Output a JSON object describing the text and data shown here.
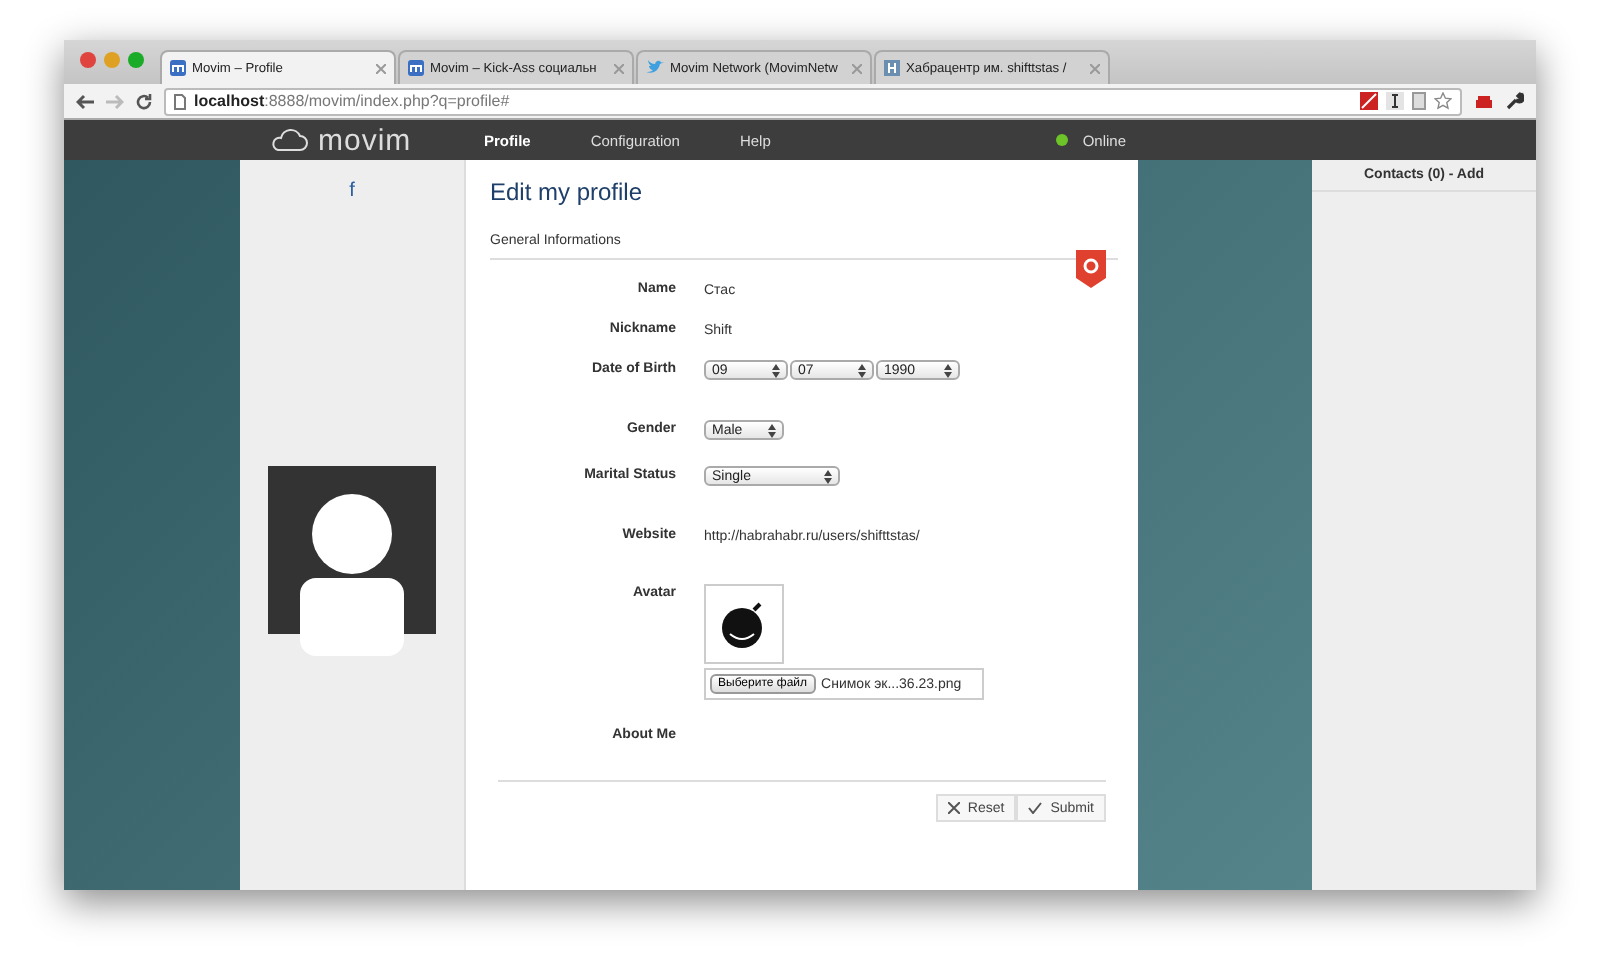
{
  "browser": {
    "tabs": [
      {
        "title": "Movim – Profile",
        "kind": "movim",
        "selected": true
      },
      {
        "title": "Movim – Kick-Ass социальн",
        "kind": "movim",
        "selected": false
      },
      {
        "title": "Movim Network (MovimNetw",
        "kind": "bird",
        "selected": false
      },
      {
        "title": "Хабрацентр им. shifttstas /",
        "kind": "habr",
        "selected": false
      }
    ],
    "url": {
      "host": "localhost",
      "rest": ":8888/movim/index.php?q=profile#"
    }
  },
  "nav": {
    "logo": "movim",
    "items": [
      {
        "label": "Profile",
        "selected": true
      },
      {
        "label": "Configuration",
        "selected": false
      },
      {
        "label": "Help",
        "selected": false
      }
    ],
    "status": {
      "label": "Online",
      "color": "#6cc428"
    }
  },
  "sidebar": {
    "link": "f"
  },
  "form": {
    "title": "Edit my profile",
    "section": "General Informations",
    "fields": [
      {
        "kind": "text",
        "label": "Name",
        "value": "Стас"
      },
      {
        "kind": "text",
        "label": "Nickname",
        "value": "Shift"
      },
      {
        "kind": "selects",
        "label": "Date of Birth",
        "values": [
          "09",
          "07",
          "1990"
        ]
      },
      {
        "kind": "selects",
        "label": "Gender",
        "values": [
          "Male"
        ]
      },
      {
        "kind": "selects",
        "label": "Marital Status",
        "values": [
          "Single"
        ]
      },
      {
        "kind": "text",
        "label": "Website",
        "value": "http://habrahabr.ru/users/shifttstas/"
      },
      {
        "kind": "avatar",
        "label": "Avatar",
        "button": "Выберите файл",
        "file": "Снимок эк...36.23.png"
      },
      {
        "kind": "empty",
        "label": "About Me"
      }
    ],
    "buttons": [
      {
        "label": "Reset",
        "kind": "reset"
      },
      {
        "label": "Submit",
        "kind": "submit"
      }
    ]
  },
  "contacts": {
    "header": "Contacts (0) - Add"
  }
}
